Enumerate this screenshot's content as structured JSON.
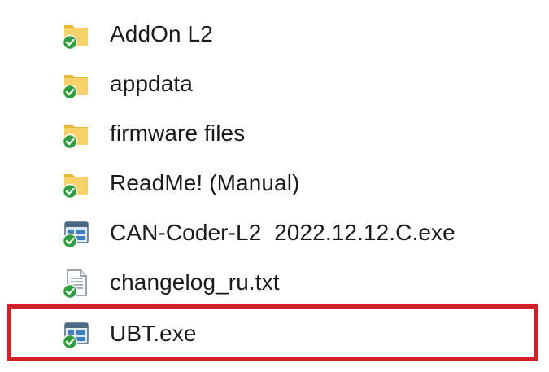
{
  "files": [
    {
      "name": "AddOn L2",
      "type": "folder",
      "icon": "folder-sync-icon"
    },
    {
      "name": "appdata",
      "type": "folder",
      "icon": "folder-sync-icon"
    },
    {
      "name": "firmware files",
      "type": "folder",
      "icon": "folder-sync-icon"
    },
    {
      "name": "ReadMe! (Manual)",
      "type": "folder",
      "icon": "folder-sync-icon"
    },
    {
      "name": "CAN-Coder-L2  2022.12.12.C.exe",
      "type": "executable",
      "icon": "exe-app-sync-icon"
    },
    {
      "name": "changelog_ru.txt",
      "type": "text",
      "icon": "text-file-sync-icon"
    },
    {
      "name": "UBT.exe",
      "type": "executable",
      "icon": "exe-app-sync-icon"
    }
  ],
  "highlight": {
    "target": "UBT.exe",
    "color": "#d2202a"
  },
  "colors": {
    "folder": "#f5c94a",
    "sync_badge": "#2e9e3e"
  }
}
